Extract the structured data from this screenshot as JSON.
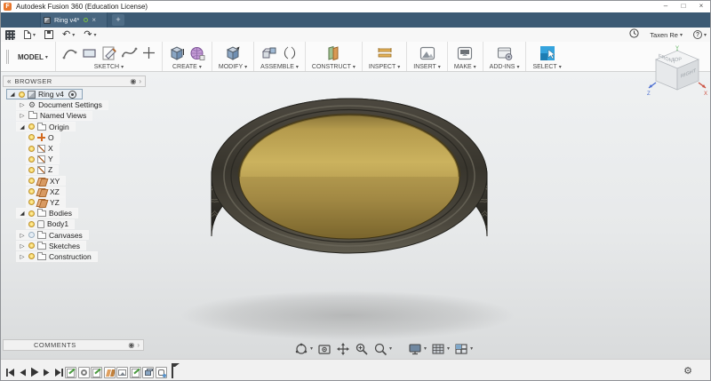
{
  "window": {
    "logo": "F",
    "title": "Autodesk Fusion 360 (Education License)",
    "minimize": "–",
    "maximize": "□",
    "close": "×"
  },
  "tabs": {
    "active": "Ring v4*",
    "close": "×",
    "new_tab": "+"
  },
  "quick_bar": {
    "user": "Taxen Re",
    "help": "?"
  },
  "toolbar": {
    "workspace": "MODEL",
    "groups": [
      {
        "label": "SKETCH"
      },
      {
        "label": "CREATE"
      },
      {
        "label": "MODIFY"
      },
      {
        "label": "ASSEMBLE"
      },
      {
        "label": "CONSTRUCT"
      },
      {
        "label": "INSPECT"
      },
      {
        "label": "INSERT"
      },
      {
        "label": "MAKE"
      },
      {
        "label": "ADD-INS"
      },
      {
        "label": "SELECT"
      }
    ]
  },
  "browser": {
    "header": "BROWSER",
    "items": [
      {
        "label": "Ring v4",
        "level": 0,
        "disclosure": "expanded",
        "bulb": "on",
        "icon": "component",
        "selected": true,
        "badge": "target"
      },
      {
        "label": "Document Settings",
        "level": 1,
        "disclosure": "collapsed",
        "icon": "gear"
      },
      {
        "label": "Named Views",
        "level": 1,
        "disclosure": "collapsed",
        "icon": "folder"
      },
      {
        "label": "Origin",
        "level": 1,
        "disclosure": "expanded",
        "bulb": "on",
        "icon": "folder"
      },
      {
        "label": "O",
        "level": 2,
        "bulb": "on",
        "icon": "origin-point"
      },
      {
        "label": "X",
        "level": 2,
        "bulb": "on",
        "icon": "axis"
      },
      {
        "label": "Y",
        "level": 2,
        "bulb": "on",
        "icon": "axis"
      },
      {
        "label": "Z",
        "level": 2,
        "bulb": "on",
        "icon": "axis"
      },
      {
        "label": "XY",
        "level": 2,
        "bulb": "on",
        "icon": "plane"
      },
      {
        "label": "XZ",
        "level": 2,
        "bulb": "on",
        "icon": "plane"
      },
      {
        "label": "YZ",
        "level": 2,
        "bulb": "on",
        "icon": "plane"
      },
      {
        "label": "Bodies",
        "level": 1,
        "disclosure": "expanded",
        "bulb": "on",
        "icon": "folder"
      },
      {
        "label": "Body1",
        "level": 2,
        "bulb": "on",
        "icon": "body"
      },
      {
        "label": "Canvases",
        "level": 1,
        "disclosure": "collapsed",
        "bulb": "off",
        "icon": "folder"
      },
      {
        "label": "Sketches",
        "level": 1,
        "disclosure": "collapsed",
        "bulb": "on",
        "icon": "folder"
      },
      {
        "label": "Construction",
        "level": 1,
        "disclosure": "collapsed",
        "bulb": "on",
        "icon": "folder"
      }
    ]
  },
  "viewcube": {
    "top": "TOP",
    "front": "FRONT",
    "right": "RIGHT",
    "axis_x": "X",
    "axis_y": "Y",
    "axis_z": "Z"
  },
  "comments": {
    "header": "COMMENTS"
  },
  "timeline": {
    "features": [
      "sketch",
      "revolve",
      "sketch",
      "construction-plane",
      "canvas",
      "sketch",
      "extrude",
      "form"
    ]
  },
  "model": {
    "document": "Ring v4",
    "body": "Body1",
    "colors": {
      "band": "#46433a",
      "gold": "#c2a854",
      "select_accent": "#35a3dd",
      "viewport_top": "#eff1f2",
      "viewport_bottom": "#d9dbdc"
    }
  },
  "ui": {
    "caret": "▾",
    "icons": {
      "expanded": "◢",
      "collapsed": "▷",
      "gear": "⚙",
      "target": "◉",
      "chevron": "›",
      "collapse": "«",
      "undo": "↶",
      "redo": "↷"
    }
  }
}
